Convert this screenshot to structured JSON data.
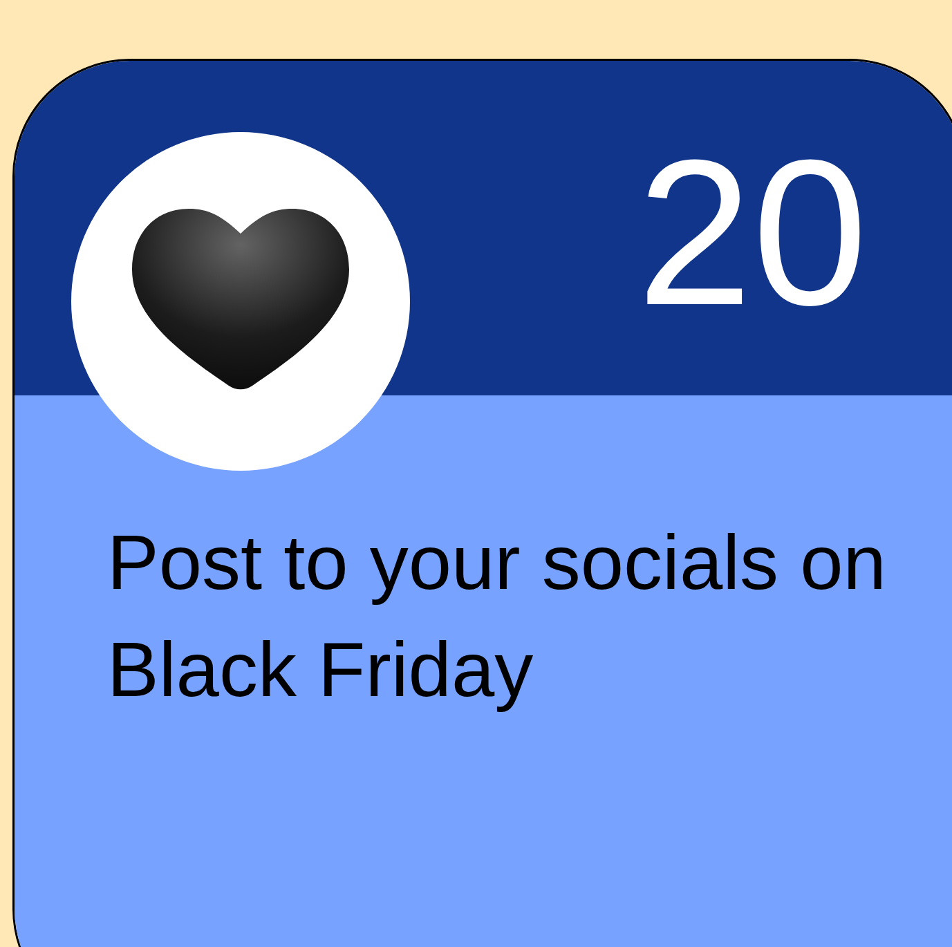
{
  "card": {
    "day": "20",
    "task": "Post to your socials on Black Friday"
  }
}
